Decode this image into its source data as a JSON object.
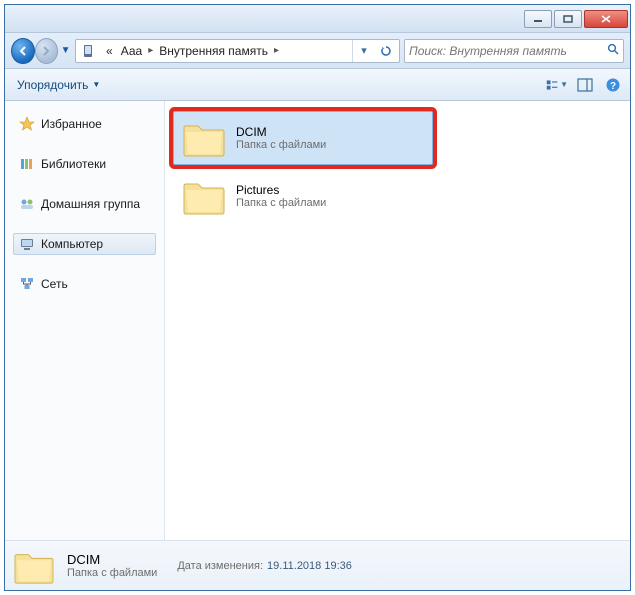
{
  "breadcrumb": {
    "prefix": "«",
    "segments": [
      "Ааа",
      "Внутренняя память"
    ]
  },
  "search": {
    "placeholder": "Поиск: Внутренняя память"
  },
  "toolbar": {
    "organize": "Упорядочить"
  },
  "sidebar": {
    "favorites": "Избранное",
    "libraries": "Библиотеки",
    "homegroup": "Домашняя группа",
    "computer": "Компьютер",
    "network": "Сеть"
  },
  "folders": [
    {
      "name": "DCIM",
      "sub": "Папка с файлами",
      "selected": true,
      "highlight": true
    },
    {
      "name": "Pictures",
      "sub": "Папка с файлами",
      "selected": false,
      "highlight": false
    }
  ],
  "status": {
    "name": "DCIM",
    "sub": "Папка с файлами",
    "meta_label": "Дата изменения:",
    "meta_value": "19.11.2018 19:36"
  }
}
